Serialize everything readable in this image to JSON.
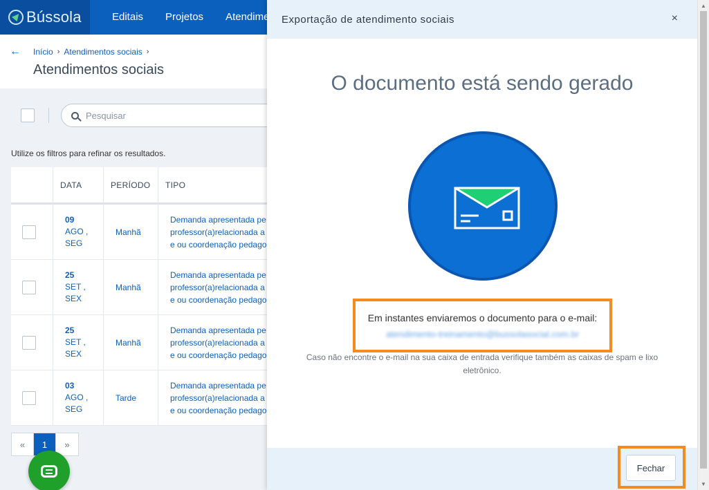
{
  "app": {
    "brand": "Bússola",
    "nav": [
      "Editais",
      "Projetos",
      "Atendimer"
    ]
  },
  "breadcrumb": {
    "home": "Início",
    "section": "Atendimentos sociais"
  },
  "page_title": "Atendimentos sociais",
  "search": {
    "placeholder": "Pesquisar"
  },
  "filter_hint": "Utilize os filtros para refinar os resultados.",
  "table": {
    "headers": [
      "DATA",
      "PERÍODO",
      "TIPO"
    ],
    "rows": [
      {
        "day": "09",
        "month": "AGO ,",
        "weekday": "SEG",
        "period": "Manhã",
        "type_lines": [
          "Demanda apresentada pe",
          "professor(a)relacionada a",
          "e ou coordenação pedago"
        ]
      },
      {
        "day": "25",
        "month": "SET ,",
        "weekday": "SEX",
        "period": "Manhã",
        "type_lines": [
          "Demanda apresentada pe",
          "professor(a)relacionada a",
          "e ou coordenação pedago"
        ]
      },
      {
        "day": "25",
        "month": "SET ,",
        "weekday": "SEX",
        "period": "Manhã",
        "type_lines": [
          "Demanda apresentada pe",
          "professor(a)relacionada a",
          "e ou coordenação pedago"
        ]
      },
      {
        "day": "03",
        "month": "AGO ,",
        "weekday": "SEG",
        "period": "Tarde",
        "type_lines": [
          "Demanda apresentada pe",
          "professor(a)relacionada a",
          "e ou coordenação pedago"
        ]
      }
    ]
  },
  "pager": {
    "prev": "«",
    "current": "1",
    "next": "»"
  },
  "icons": {
    "back": "arrow-left-icon",
    "search": "search-icon",
    "close": "close-icon",
    "envelope": "envelope-icon",
    "chat": "chat-icon"
  },
  "modal": {
    "title": "Exportação de atendimento sociais",
    "close_label": "×",
    "heading": "O documento está sendo gerado",
    "email_message": "Em instantes enviaremos o documento para o e-mail:",
    "email_address": "atendimento-treinamento@bussolasocial.com.br",
    "spam_note": "Caso não encontre o e-mail na sua caixa de entrada verifique também as caixas de spam e lixo eletrônico.",
    "close_button": "Fechar"
  },
  "colors": {
    "primary": "#0b5fbd",
    "highlight": "#f58a1f",
    "chat": "#1ea02a",
    "envelope_flap": "#1fcf73"
  }
}
